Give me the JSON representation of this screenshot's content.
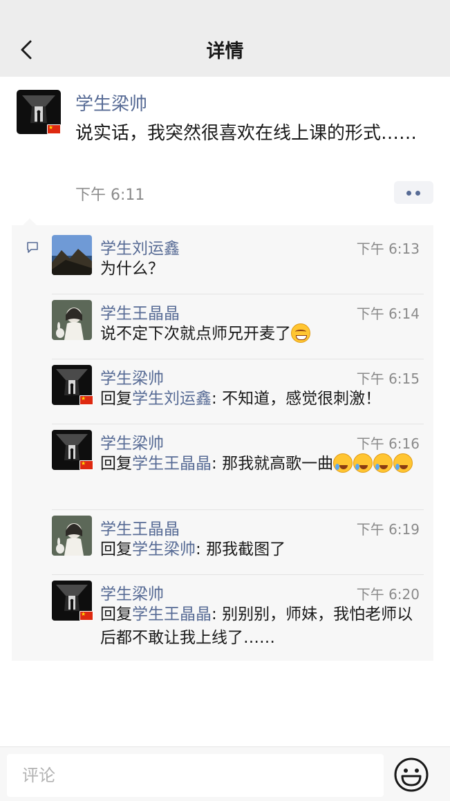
{
  "nav": {
    "title": "详情",
    "back_icon": "chevron-left-icon"
  },
  "post": {
    "author": "学生梁帅",
    "text": "说实话，我突然很喜欢在线上课的形式……",
    "time": "下午 6:11",
    "more_icon": "more-dots-icon"
  },
  "comments": [
    {
      "name": "学生刘运鑫",
      "time": "下午 6:13",
      "reply_prefix": "",
      "reply_to": "",
      "reply_sep": "",
      "text": "为什么？"
    },
    {
      "name": "学生王晶晶",
      "time": "下午 6:14",
      "reply_prefix": "",
      "reply_to": "",
      "reply_sep": "",
      "text": "说不定下次就点师兄开麦了"
    },
    {
      "name": "学生梁帅",
      "time": "下午 6:15",
      "reply_prefix": "回复",
      "reply_to": "学生刘运鑫",
      "reply_sep": ": ",
      "text": "不知道，感觉很刺激！"
    },
    {
      "name": "学生梁帅",
      "time": "下午 6:16",
      "reply_prefix": "回复",
      "reply_to": "学生王晶晶",
      "reply_sep": ": ",
      "text": "那我就高歌一曲"
    },
    {
      "name": "学生王晶晶",
      "time": "下午 6:19",
      "reply_prefix": "回复",
      "reply_to": "学生梁帅",
      "reply_sep": ": ",
      "text": "那我截图了"
    },
    {
      "name": "学生梁帅",
      "time": "下午 6:20",
      "reply_prefix": "回复",
      "reply_to": "学生王晶晶",
      "reply_sep": ": ",
      "text": "别别别，师妹，我怕老师以后都不敢让我上线了……"
    }
  ],
  "input": {
    "placeholder": "评论"
  },
  "colors": {
    "link": "#576b95",
    "nav_bg": "#ededed",
    "comment_bg": "#f7f7f7",
    "time": "#8a8a8a"
  }
}
